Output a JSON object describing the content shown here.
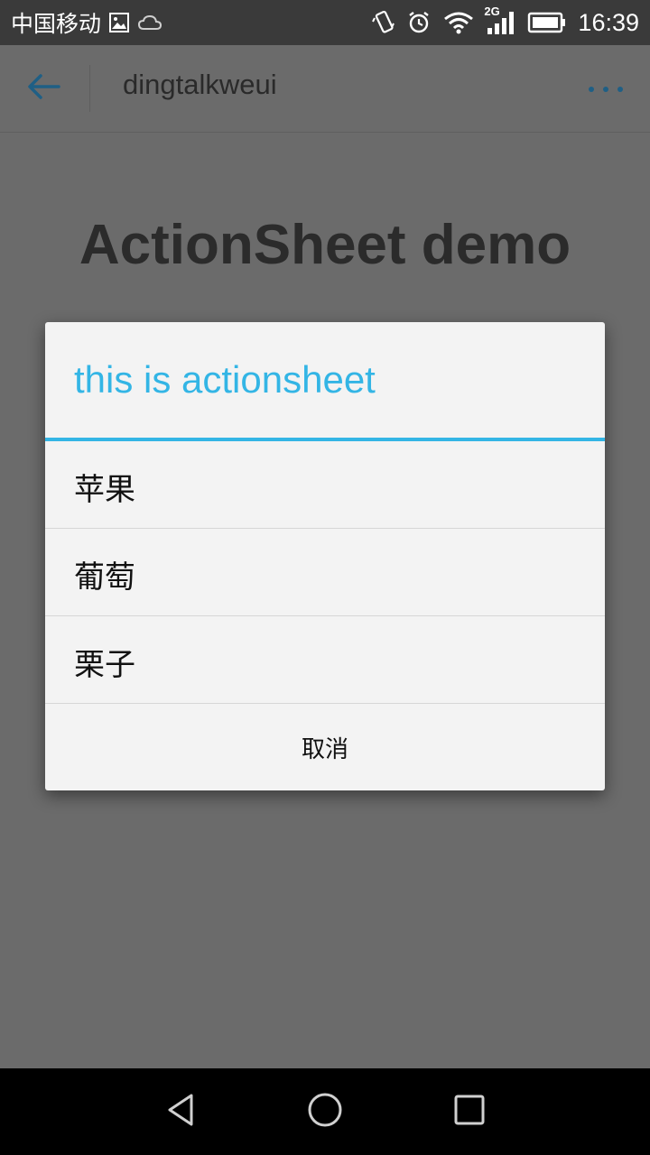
{
  "status_bar": {
    "carrier": "中国移动",
    "network_type": "2G",
    "time": "16:39",
    "icons": [
      "image-icon",
      "cloud-icon",
      "vibrate-icon",
      "alarm-icon",
      "wifi-icon",
      "signal-icon",
      "battery-icon"
    ]
  },
  "header": {
    "title": "dingtalkweui",
    "back_icon": "back-arrow-icon",
    "more_icon": "more-dots-icon",
    "accent_color": "#1f5f85"
  },
  "page": {
    "heading": "ActionSheet demo"
  },
  "action_sheet": {
    "title": "this is actionsheet",
    "accent_color": "#33b5e5",
    "items": [
      {
        "label": "苹果"
      },
      {
        "label": "葡萄"
      },
      {
        "label": "栗子"
      }
    ],
    "cancel_label": "取消"
  },
  "nav_bar": {
    "buttons": [
      "back-triangle-icon",
      "home-circle-icon",
      "recents-square-icon"
    ]
  }
}
